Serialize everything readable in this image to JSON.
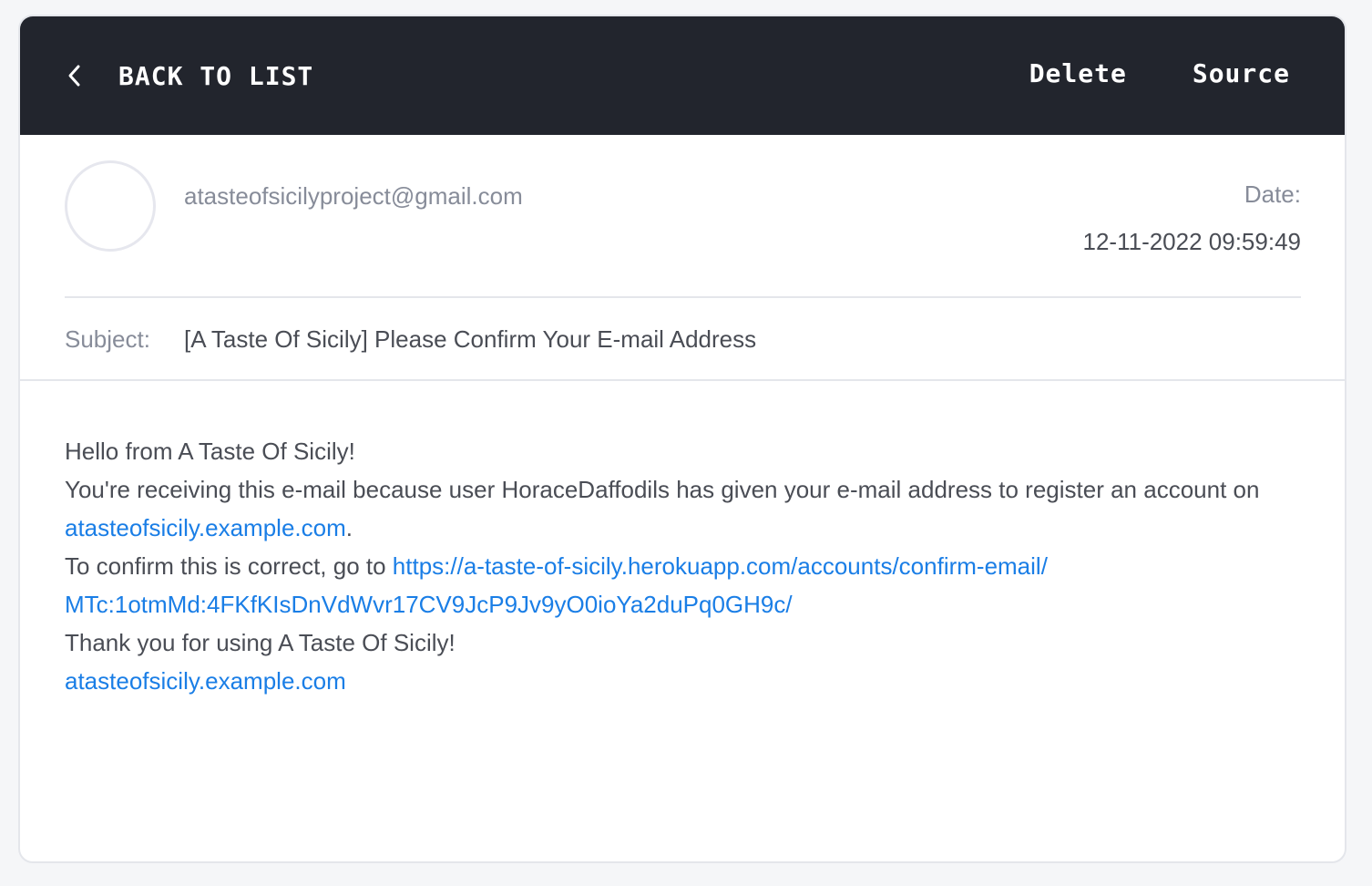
{
  "toolbar": {
    "back_label": "BACK TO LIST",
    "delete_label": "Delete",
    "source_label": "Source"
  },
  "message": {
    "from": "atasteofsicilyproject@gmail.com",
    "date_label": "Date:",
    "date_value": "12-11-2022 09:59:49",
    "subject_label": "Subject:",
    "subject_value": "[A Taste Of Sicily] Please Confirm Your E-mail Address"
  },
  "body": {
    "greeting": "Hello from A Taste Of Sicily!",
    "line2_text": "You're receiving this e-mail because user HoraceDaffodils has given your e-mail address to register an account on ",
    "line2_link": "atasteofsicily.example.com",
    "line2_end": ".",
    "line3_text": "To confirm this is correct, go to ",
    "line3_link": "https://a-taste-of-sicily.herokuapp.com/accounts/confirm-email/MTc:1otmMd:4FKfKIsDnVdWvr17CV9JcP9Jv9yO0ioYa2duPq0GH9c/",
    "thanks": "Thank you for using A Taste Of Sicily!",
    "footer_link": "atasteofsicily.example.com"
  },
  "colors": {
    "topbar": "#22252d",
    "link": "#1a7ee6",
    "muted_text": "#878c99",
    "body_text": "#4a4d55"
  },
  "icons": {
    "back": "chevron-left-icon",
    "avatar": "avatar-placeholder"
  }
}
